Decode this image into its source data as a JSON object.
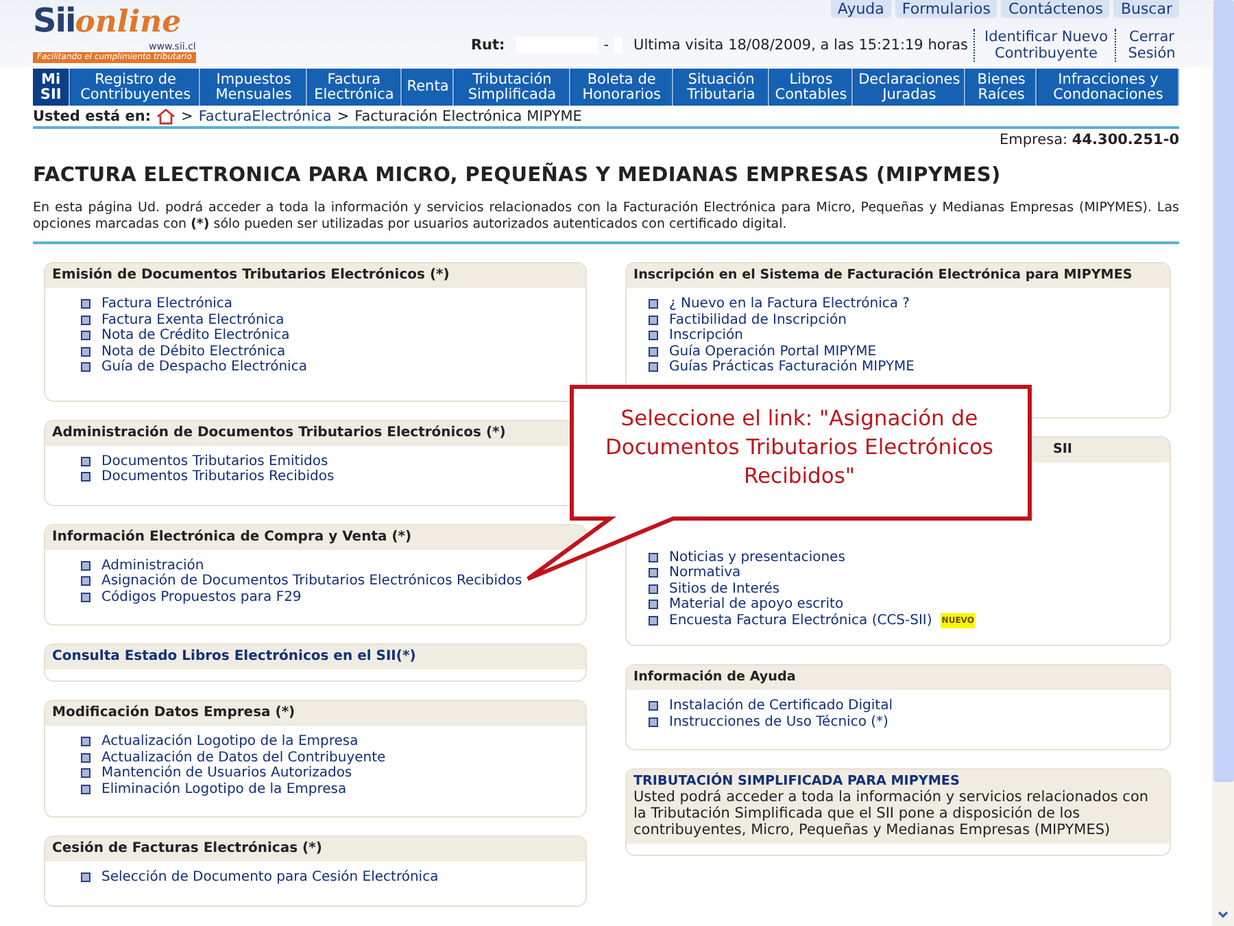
{
  "header": {
    "logo": {
      "brand_a": "Sii",
      "brand_b": "online",
      "url": "www.sii.cl",
      "tagline": "Facilitando el cumplimiento tributario"
    },
    "top_links": [
      "Ayuda",
      "Formularios",
      "Contáctenos",
      "Buscar"
    ],
    "rut_label": "Rut:",
    "rut_separator": "-",
    "last_visit": "Ultima visita 18/08/2009, a las 15:21:19 horas",
    "user_links": [
      "Identificar Nuevo Contribuyente",
      "Cerrar Sesión"
    ]
  },
  "nav": [
    {
      "label": "Mi SII",
      "selected": true
    },
    {
      "label": "Registro de Contribuyentes",
      "selected": false
    },
    {
      "label": "Impuestos Mensuales",
      "selected": false
    },
    {
      "label": "Factura Electrónica",
      "selected": false
    },
    {
      "label": "Renta",
      "selected": false
    },
    {
      "label": "Tributación Simplificada",
      "selected": false
    },
    {
      "label": "Boleta de Honorarios",
      "selected": false
    },
    {
      "label": "Situación Tributaria",
      "selected": false
    },
    {
      "label": "Libros Contables",
      "selected": false
    },
    {
      "label": "Declaraciones Juradas",
      "selected": false
    },
    {
      "label": "Bienes Raíces",
      "selected": false
    },
    {
      "label": "Infracciones y Condonaciones",
      "selected": false
    }
  ],
  "breadcrumb": {
    "label": "Usted está en:",
    "separator": ">",
    "items": [
      {
        "text": "FacturaElectrónica",
        "link": true
      },
      {
        "text": "Facturación Electrónica MIPYME",
        "link": false
      }
    ]
  },
  "company": {
    "label": "Empresa:",
    "value": "44.300.251-0"
  },
  "title": "FACTURA ELECTRONICA PARA MICRO, PEQUEÑAS Y MEDIANAS EMPRESAS (MIPYMES)",
  "intro": "En esta página Ud. podrá acceder a toda la información y servicios relacionados con la Facturación Electrónica para Micro, Pequeñas y Medianas Empresas (MIPYMES). Las opciones marcadas con **(*)** sólo pueden ser utilizadas por usuarios autorizados autenticados con certificado digital.",
  "left_cards": [
    {
      "kind": "list",
      "title": "Emisión de Documentos Tributarios Electrónicos (*)",
      "items": [
        {
          "text": "Factura Electrónica"
        },
        {
          "text": "Factura Exenta Electrónica"
        },
        {
          "text": "Nota de Crédito Electrónica"
        },
        {
          "text": "Nota de Débito Electrónica"
        },
        {
          "text": "Guía de Despacho Electrónica"
        }
      ]
    },
    {
      "kind": "list",
      "title": "Administración de Documentos Tributarios Electrónicos (*)",
      "items": [
        {
          "text": "Documentos Tributarios Emitidos"
        },
        {
          "text": "Documentos Tributarios Recibidos"
        }
      ]
    },
    {
      "kind": "list",
      "title": "Información Electrónica de Compra y Venta (*)",
      "items": [
        {
          "text": "Administración"
        },
        {
          "text": "Asignación de Documentos Tributarios Electrónicos Recibidos"
        },
        {
          "text": "Códigos Propuestos para F29"
        }
      ]
    },
    {
      "kind": "link_title",
      "title": "Consulta Estado Libros Electrónicos en el SII(*)"
    },
    {
      "kind": "list",
      "title": "Modificación Datos Empresa (*)",
      "items": [
        {
          "text": "Actualización Logotipo de la Empresa"
        },
        {
          "text": "Actualización de Datos del Contribuyente"
        },
        {
          "text": "Mantención de Usuarios Autorizados"
        },
        {
          "text": "Eliminación Logotipo de la Empresa"
        }
      ]
    },
    {
      "kind": "list",
      "title": "Cesión de Facturas Electrónicas (*)",
      "items": [
        {
          "text": "Selección de Documento para Cesión Electrónica"
        }
      ]
    }
  ],
  "right_cards": [
    {
      "kind": "list",
      "title": "Inscripción en el Sistema de Facturación Electrónica para MIPYMES",
      "items": [
        {
          "text": "¿ Nuevo en la Factura Electrónica ?"
        },
        {
          "text": "Factibilidad de Inscripción"
        },
        {
          "text": "Inscripción"
        },
        {
          "text": "Guía Operación Portal MIPYME"
        },
        {
          "text": "Guías Prácticas Facturación MIPYME"
        }
      ]
    },
    {
      "kind": "covered",
      "title": "SII",
      "items": [
        {
          "text": "Noticias y presentaciones"
        },
        {
          "text": "Normativa"
        },
        {
          "text": "Sitios de Interés"
        },
        {
          "text": "Material de apoyo escrito"
        },
        {
          "text": "Encuesta Factura Electrónica (CCS-SII)",
          "badge": "NUEVO"
        }
      ]
    },
    {
      "kind": "list",
      "title": "Información de Ayuda",
      "items": [
        {
          "text": "Instalación de Certificado Digital"
        },
        {
          "text": "Instrucciones de Uso Técnico (*)"
        }
      ]
    },
    {
      "kind": "text",
      "title": "TRIBUTACIÓN SIMPLIFICADA PARA MIPYMES",
      "text": "Usted podrá acceder a toda la información y servicios relacionados con la Tributación Simplificada que el SII pone a disposición de los contribuyentes, Micro, Pequeñas y Medianas Empresas (MIPYMES)"
    }
  ],
  "callout": "Seleccione el link: \"Asignación de Documentos Tributarios Electrónicos Recibidos\""
}
